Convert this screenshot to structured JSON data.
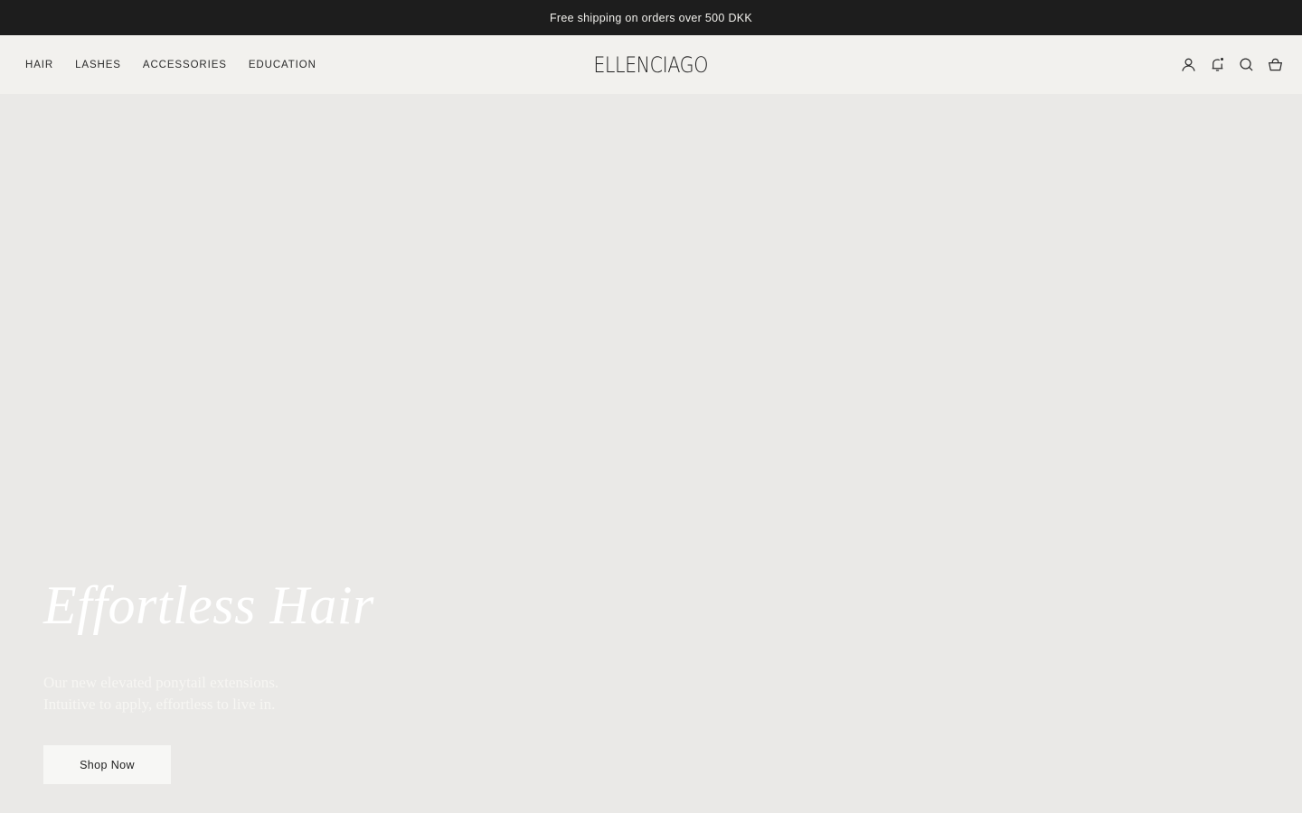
{
  "announcement": {
    "text": "Free shipping on orders over 500 DKK"
  },
  "header": {
    "nav": [
      {
        "label": "HAIR"
      },
      {
        "label": "LASHES"
      },
      {
        "label": "ACCESSORIES"
      },
      {
        "label": "EDUCATION"
      }
    ],
    "logo": "ELLENCIAGO",
    "icons": [
      "account-icon",
      "notification-bell-icon",
      "search-icon",
      "cart-basket-icon"
    ]
  },
  "hero": {
    "title": "Effortless Hair",
    "subtitle_lines": [
      "Our new elevated ponytail extensions.",
      "Intuitive to apply, effortless to live in."
    ],
    "cta_label": "Shop Now"
  },
  "colors": {
    "announcement_bg": "#1d1d1d",
    "header_bg": "#f2f1ee",
    "hero_bg": "#eae9e7",
    "cta_bg": "#f7f7f5"
  }
}
